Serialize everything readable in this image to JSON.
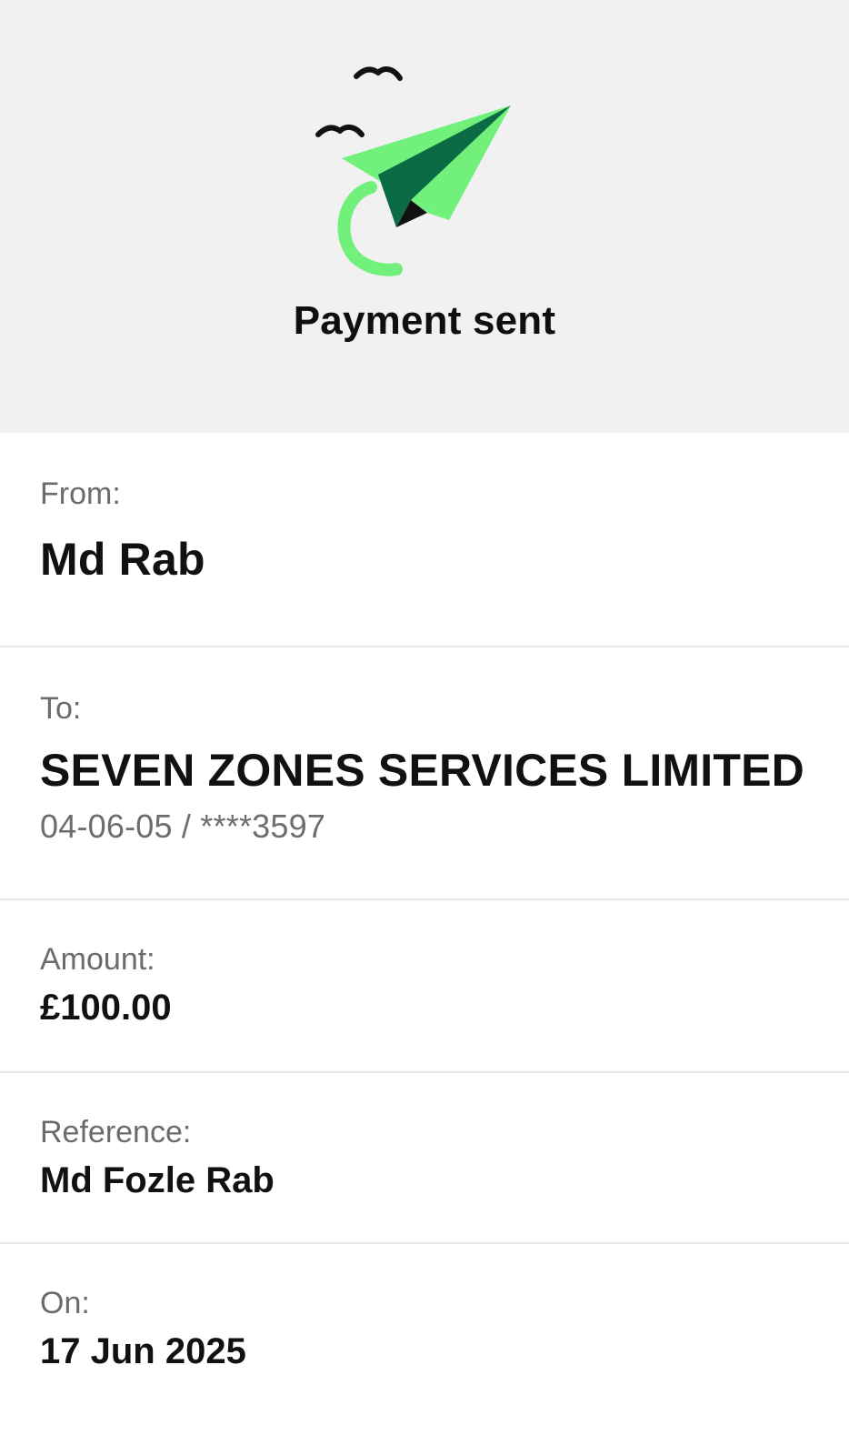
{
  "header": {
    "title": "Payment sent",
    "illustration": "paper-plane-with-birds-icon",
    "colors": {
      "plane_light": "#72f07c",
      "plane_dark": "#0a6b45",
      "ink": "#111111",
      "background": "#f1f1f1"
    }
  },
  "details": {
    "from": {
      "label": "From:",
      "name": "Md Rab"
    },
    "to": {
      "label": "To:",
      "name": "SEVEN ZONES SERVICES LIMITED",
      "account": "04-06-05 / ****3597"
    },
    "amount": {
      "label": "Amount:",
      "value": "£100.00"
    },
    "reference": {
      "label": "Reference:",
      "value": "Md Fozle Rab"
    },
    "date": {
      "label": "On:",
      "value": "17 Jun 2025"
    }
  }
}
